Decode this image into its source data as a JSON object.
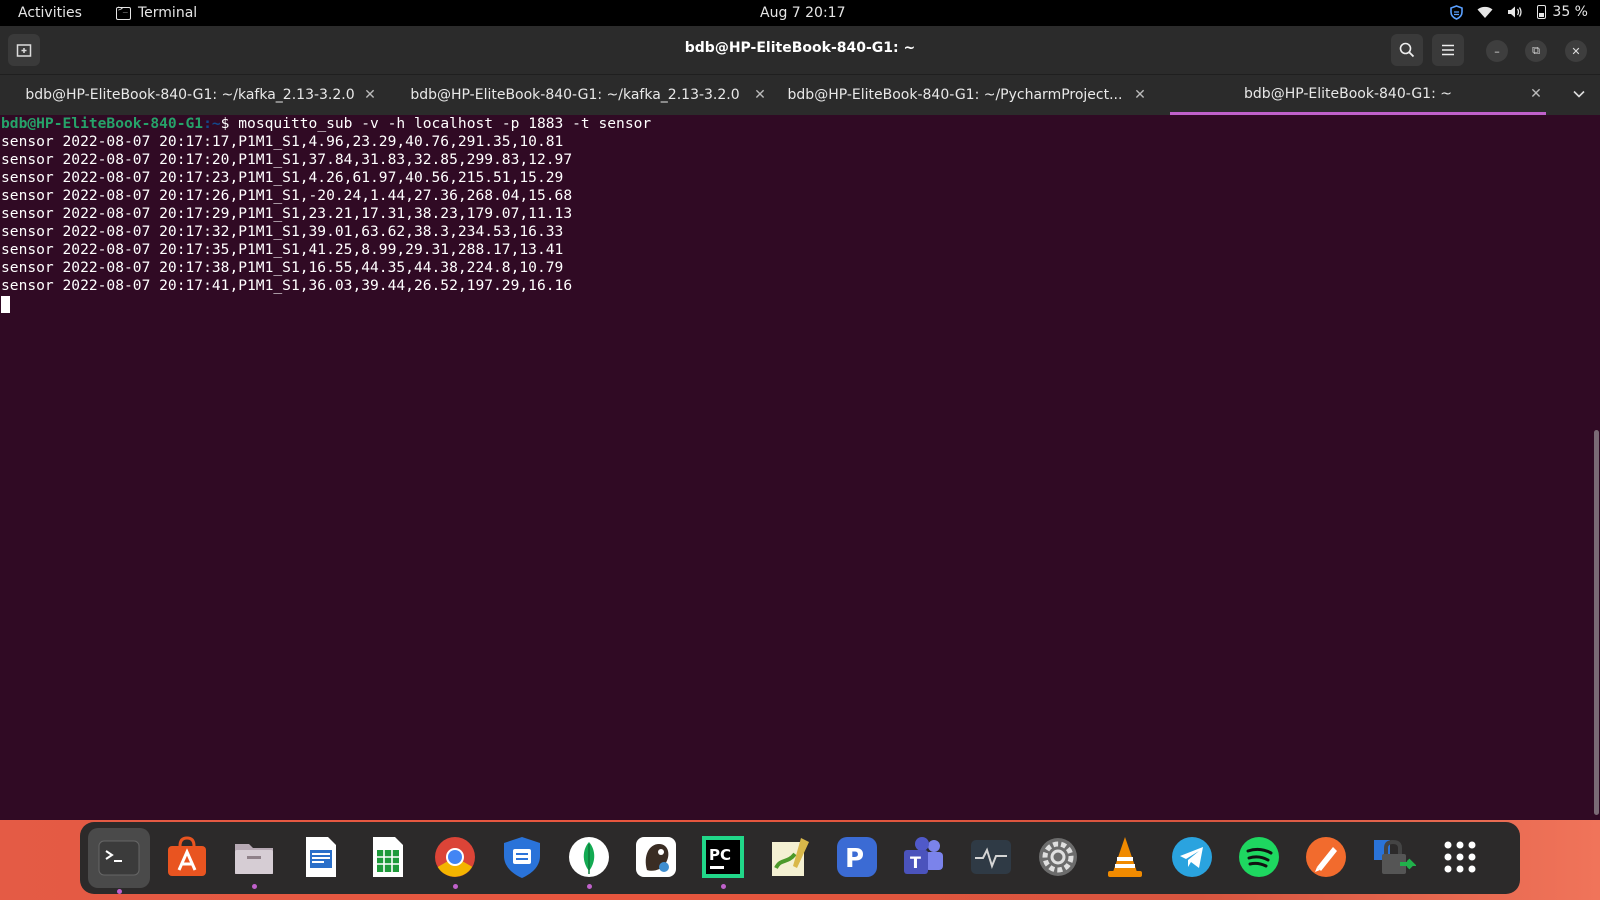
{
  "topbar": {
    "activities": "Activities",
    "app_name": "Terminal",
    "clock": "Aug 7  20:17",
    "battery": "35 %"
  },
  "window": {
    "title": "bdb@HP-EliteBook-840-G1: ~"
  },
  "tabs": [
    {
      "label": "bdb@HP-EliteBook-840-G1: ~/kafka_2.13-3.2.0",
      "active": false
    },
    {
      "label": "bdb@HP-EliteBook-840-G1: ~/kafka_2.13-3.2.0",
      "active": false
    },
    {
      "label": "bdb@HP-EliteBook-840-G1: ~/PycharmProject...",
      "active": false
    },
    {
      "label": "bdb@HP-EliteBook-840-G1: ~",
      "active": true
    }
  ],
  "terminal": {
    "prompt_user": "bdb@HP-EliteBook-840-G1",
    "prompt_path": ":~",
    "prompt_symbol": "$ ",
    "command": "mosquitto_sub -v -h localhost -p 1883 -t sensor",
    "output": [
      "sensor 2022-08-07 20:17:17,P1M1_S1,4.96,23.29,40.76,291.35,10.81",
      "sensor 2022-08-07 20:17:20,P1M1_S1,37.84,31.83,32.85,299.83,12.97",
      "sensor 2022-08-07 20:17:23,P1M1_S1,4.26,61.97,40.56,215.51,15.29",
      "sensor 2022-08-07 20:17:26,P1M1_S1,-20.24,1.44,27.36,268.04,15.68",
      "sensor 2022-08-07 20:17:29,P1M1_S1,23.21,17.31,38.23,179.07,11.13",
      "sensor 2022-08-07 20:17:32,P1M1_S1,39.01,63.62,38.3,234.53,16.33",
      "sensor 2022-08-07 20:17:35,P1M1_S1,41.25,8.99,29.31,288.17,13.41",
      "sensor 2022-08-07 20:17:38,P1M1_S1,16.55,44.35,44.38,224.8,10.79",
      "sensor 2022-08-07 20:17:41,P1M1_S1,36.03,39.44,26.52,197.29,16.16"
    ]
  },
  "colors": {
    "terminal_bg": "#300a24",
    "prompt_user": "#26a269",
    "prompt_path": "#12488b",
    "tab_accent": "#c061cb"
  },
  "dock": [
    {
      "icon": "terminal-icon",
      "running": true,
      "selected": true
    },
    {
      "icon": "software-center-icon",
      "running": false
    },
    {
      "icon": "files-icon",
      "running": true
    },
    {
      "icon": "writer-icon",
      "running": false
    },
    {
      "icon": "calc-icon",
      "running": false
    },
    {
      "icon": "chrome-icon",
      "running": true
    },
    {
      "icon": "shield-app-icon",
      "running": false
    },
    {
      "icon": "mongodb-icon",
      "running": true
    },
    {
      "icon": "dbeaver-icon",
      "running": false
    },
    {
      "icon": "pycharm-icon",
      "running": true
    },
    {
      "icon": "notes-icon",
      "running": false
    },
    {
      "icon": "postman-icon",
      "running": false
    },
    {
      "icon": "teams-icon",
      "running": false
    },
    {
      "icon": "system-monitor-icon",
      "running": false
    },
    {
      "icon": "settings-icon",
      "running": false
    },
    {
      "icon": "vlc-icon",
      "running": false
    },
    {
      "icon": "telegram-icon",
      "running": false
    },
    {
      "icon": "spotify-icon",
      "running": false
    },
    {
      "icon": "pen-app-icon",
      "running": false
    },
    {
      "icon": "lock-app-icon",
      "running": false
    },
    {
      "icon": "app-grid-icon",
      "running": false
    }
  ]
}
